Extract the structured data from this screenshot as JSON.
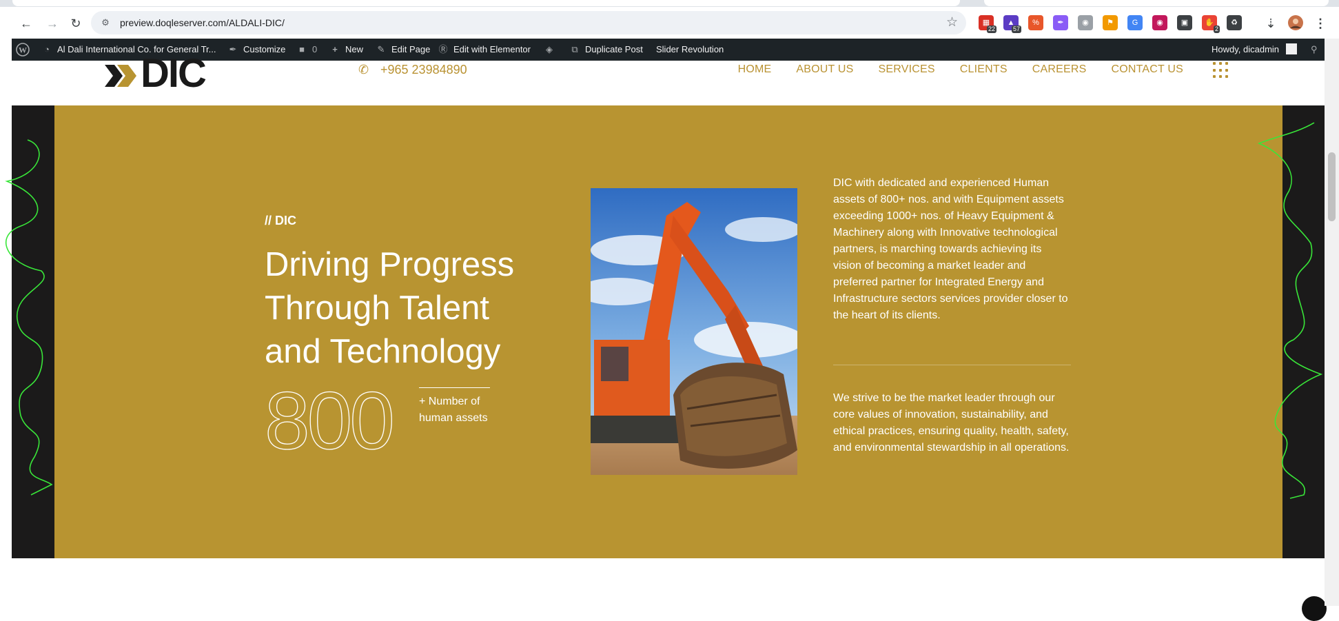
{
  "browser": {
    "url": "preview.doqleserver.com/ALDALI-DIC/",
    "extensions": [
      {
        "name": "calendar-ext-icon",
        "badge": "22",
        "color": "#d93025"
      },
      {
        "name": "hat-ext-icon",
        "badge": "57",
        "color": "#5b3cc4"
      },
      {
        "name": "percent-ext-icon",
        "badge": "",
        "color": "#e8562a"
      },
      {
        "name": "pen-ext-icon",
        "badge": "",
        "color": "#8a5cf6"
      },
      {
        "name": "camera-ext-icon",
        "badge": "",
        "color": "#9aa0a6"
      },
      {
        "name": "key-ext-icon",
        "badge": "",
        "color": "#f29900"
      },
      {
        "name": "translate-ext-icon",
        "badge": "",
        "color": "#4285f4"
      },
      {
        "name": "color-wheel-ext-icon",
        "badge": "",
        "color": "#c2185b"
      },
      {
        "name": "clapper-ext-icon",
        "badge": "",
        "color": "#3c4043"
      },
      {
        "name": "hand-ext-icon",
        "badge": "2",
        "color": "#ea4335"
      },
      {
        "name": "puzzle-ext-icon",
        "badge": "",
        "color": "#3c4043"
      }
    ]
  },
  "wpbar": {
    "site": "Al Dali International Co. for General Tr...",
    "customize": "Customize",
    "comments": "0",
    "new": "New",
    "edit_page": "Edit Page",
    "edit_elementor": "Edit with Elementor",
    "duplicate": "Duplicate Post",
    "slider": "Slider Revolution",
    "howdy": "Howdy, dicadmin"
  },
  "header": {
    "logo_text": "DIC",
    "phone": "+965 23984890",
    "nav": [
      "HOME",
      "ABOUT US",
      "SERVICES",
      "CLIENTS",
      "CAREERS",
      "CONTACT US"
    ]
  },
  "hero": {
    "kicker": "// DIC",
    "headline": "Driving Progress Through Talent and Technology",
    "stat_number": "800",
    "stat_label": "+ Number of human assets",
    "para1": "DIC with dedicated and experienced Human assets of 800+ nos. and with Equipment assets exceeding 1000+ nos. of Heavy Equipment & Machinery along with Innovative technological partners, is marching towards achieving its vision of becoming a market leader and preferred partner for Integrated Energy and Infrastructure sectors services provider closer to the heart of its clients.",
    "para2": "We strive to be the market leader through our core values of innovation, sustainability, and ethical practices, ensuring quality, health, safety, and environmental stewardship in all operations."
  },
  "colors": {
    "brand_gold": "#b89431",
    "dark": "#1b1a1a",
    "wpbar": "#1d2327",
    "annotation": "#39e639"
  }
}
